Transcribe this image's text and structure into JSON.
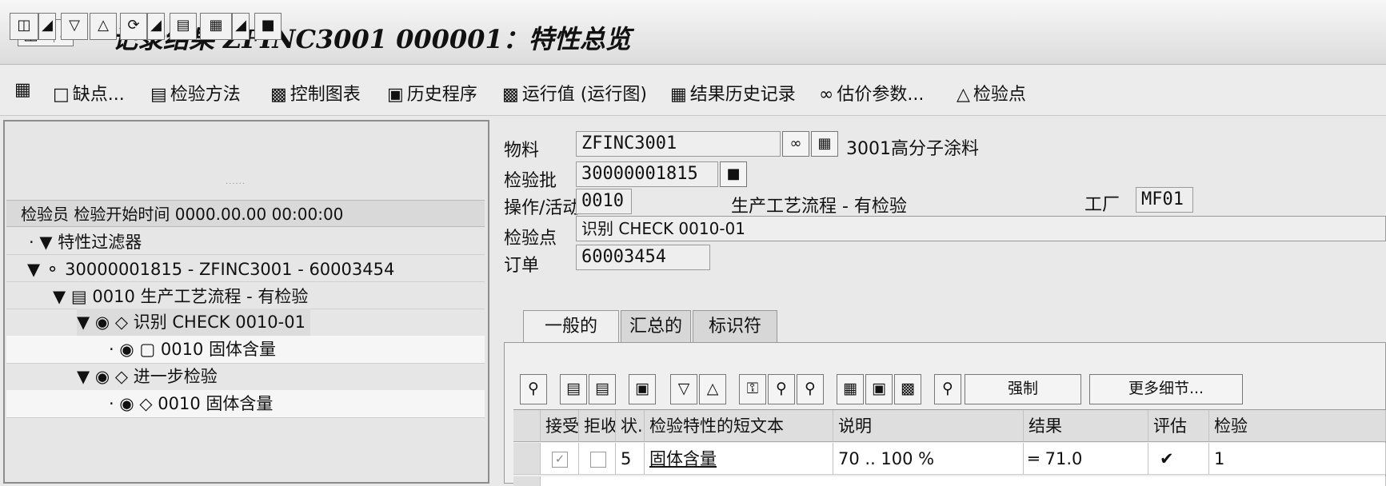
{
  "window": {
    "title": "记录结果 ZFINC3001 000001：特性总览",
    "menu_icon": "screen-menu-icon"
  },
  "app_toolbar": {
    "items": [
      {
        "label": "缺点...",
        "icon": "document-icon"
      },
      {
        "label": "检验方法",
        "icon": "method-icon"
      },
      {
        "label": "控制图表",
        "icon": "chart-icon"
      },
      {
        "label": "历史程序",
        "icon": "history-icon"
      },
      {
        "label": "运行值 (运行图)",
        "icon": "run-chart-icon"
      },
      {
        "label": "结果历史记录",
        "icon": "results-history-icon"
      },
      {
        "label": "估价参数...",
        "icon": "glasses-icon"
      },
      {
        "label": "检验点",
        "icon": "inspection-point-icon"
      }
    ]
  },
  "tree": {
    "header": "检验员 检验开始时间 0000.00.00 00:00:00",
    "nodes": [
      {
        "label": "特性过滤器"
      },
      {
        "label": "30000001815 - ZFINC3001 - 60003454"
      },
      {
        "label": "0010 生产工艺流程 - 有检验"
      },
      {
        "label": "识别 CHECK 0010-01"
      },
      {
        "label": "0010 固体含量"
      },
      {
        "label": "进一步检验"
      },
      {
        "label": "0010 固体含量"
      }
    ]
  },
  "header_fields": {
    "material_label": "物料",
    "material_value": "ZFINC3001",
    "material_desc": "3001高分子涂料",
    "lot_label": "检验批",
    "lot_value": "30000001815",
    "operation_label": "操作/活动",
    "operation_value": "0010",
    "operation_desc": "生产工艺流程 - 有检验",
    "plant_label": "工厂",
    "plant_value": "MF01",
    "point_label": "检验点",
    "point_value": "识别 CHECK 0010-01",
    "order_label": "订单",
    "order_value": "60003454"
  },
  "tabs": [
    "一般的",
    "汇总的",
    "标识符"
  ],
  "grid_toolbar": {
    "force_label": "强制",
    "more_details_label": "更多细节..."
  },
  "grid": {
    "columns": [
      "接受",
      "拒收",
      "状.",
      "检验特性的短文本",
      "说明",
      "结果",
      "评估",
      "检验"
    ],
    "rows": [
      {
        "accept": true,
        "reject": false,
        "status": "5",
        "short_text": "固体含量",
        "description": "70 .. 100 %",
        "result": "71.0",
        "evaluation": "✔",
        "inspected": "1"
      }
    ]
  }
}
